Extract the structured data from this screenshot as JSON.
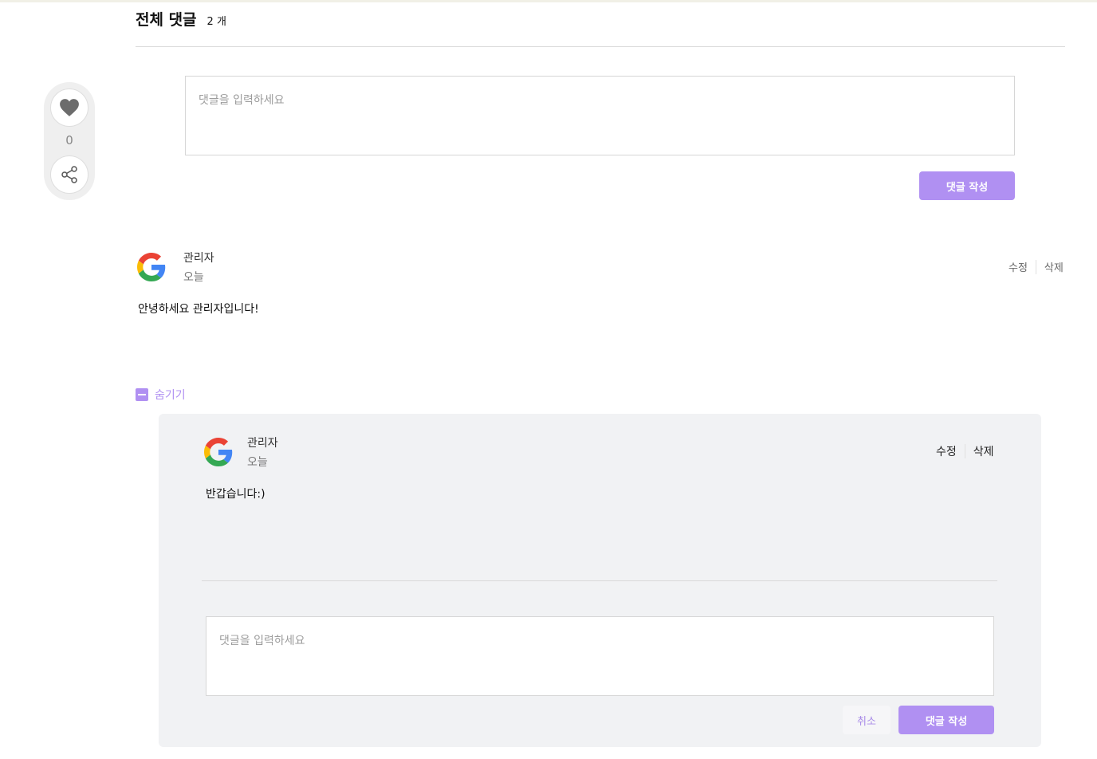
{
  "header": {
    "title": "전체 댓글",
    "count": "2 개"
  },
  "reactions": {
    "like_count": "0",
    "like_icon": "heart-icon",
    "share_icon": "share-icon"
  },
  "comment_form": {
    "placeholder": "댓글을 입력하세요",
    "submit_label": "댓글 작성"
  },
  "comments": [
    {
      "author": "관리자",
      "date": "오늘",
      "body": "안녕하세요 관리자입니다!",
      "edit_label": "수정",
      "delete_label": "삭제",
      "avatar_icon": "google-logo-icon"
    }
  ],
  "replies_toggle": {
    "label": "숨기기"
  },
  "replies": [
    {
      "author": "관리자",
      "date": "오늘",
      "body": "반갑습니다:)",
      "edit_label": "수정",
      "delete_label": "삭제",
      "avatar_icon": "google-logo-icon"
    }
  ],
  "reply_form": {
    "placeholder": "댓글을 입력하세요",
    "cancel_label": "취소",
    "submit_label": "댓글 작성"
  },
  "colors": {
    "accent": "#b090f2",
    "panel_bg": "#f1f2f4",
    "muted_text": "#777777"
  }
}
